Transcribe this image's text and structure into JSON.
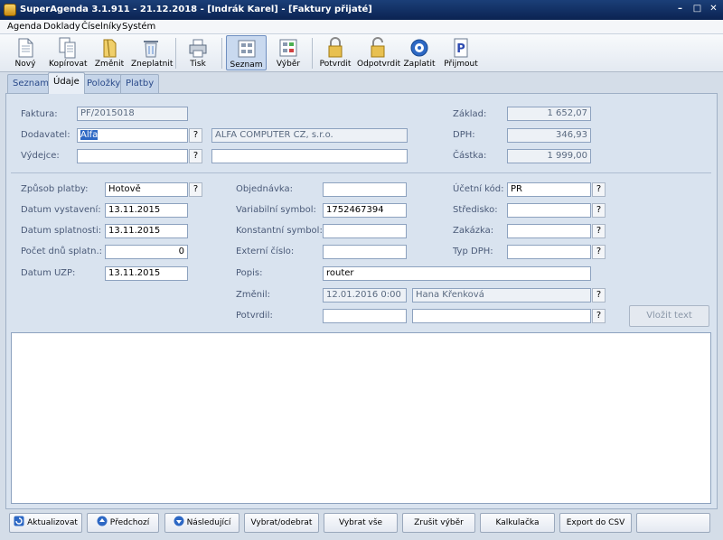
{
  "window": {
    "title": "SuperAgenda 3.1.911 - 21.12.2018 - [Indrák Karel] - [Faktury přijaté]",
    "minimize": "–",
    "restore": "□",
    "close": "✕"
  },
  "menu": [
    "Agenda",
    "Doklady",
    "Číselníky",
    "Systém"
  ],
  "toolbar": {
    "novy": "Nový",
    "kopirovat": "Kopírovat",
    "zmenit": "Změnit",
    "zneplatnit": "Zneplatnit",
    "tisk": "Tisk",
    "seznam": "Seznam",
    "vyber": "Výběr",
    "potvrdit": "Potvrdit",
    "odpotvrdit": "Odpotvrdit",
    "zaplatit": "Zaplatit",
    "prijmout": "Přijmout"
  },
  "tabs": [
    "Seznam",
    "Údaje",
    "Položky",
    "Platby"
  ],
  "form": {
    "faktura": {
      "label": "Faktura:",
      "value": "PF/2015018"
    },
    "dodavatel": {
      "label": "Dodavatel:",
      "value": "Alfa",
      "name": "ALFA COMPUTER CZ, s.r.o."
    },
    "vydejce": {
      "label": "Výdejce:",
      "value": "",
      "name": ""
    },
    "zaklad": {
      "label": "Základ:",
      "value": "1 652,07"
    },
    "dph": {
      "label": "DPH:",
      "value": "346,93"
    },
    "castka": {
      "label": "Částka:",
      "value": "1 999,00"
    },
    "zpusob_platby": {
      "label": "Způsob platby:",
      "value": "Hotově"
    },
    "datum_vystaveni": {
      "label": "Datum vystavení:",
      "value": "13.11.2015"
    },
    "datum_splatnosti": {
      "label": "Datum splatnosti:",
      "value": "13.11.2015"
    },
    "pocet_dnu": {
      "label": "Počet dnů splatn.:",
      "value": "0"
    },
    "datum_uzp": {
      "label": "Datum UZP:",
      "value": "13.11.2015"
    },
    "objednavka": {
      "label": "Objednávka:",
      "value": ""
    },
    "variabilni": {
      "label": "Variabilní symbol:",
      "value": "1752467394"
    },
    "konstantni": {
      "label": "Konstantní symbol:",
      "value": ""
    },
    "externi": {
      "label": "Externí číslo:",
      "value": ""
    },
    "popis": {
      "label": "Popis:",
      "value": "router"
    },
    "zmenil": {
      "label": "Změnil:",
      "date": "12.01.2016 0:00",
      "user": "Hana Křenková"
    },
    "potvrdil": {
      "label": "Potvrdil:",
      "date": "",
      "user": ""
    },
    "ucetni_kod": {
      "label": "Účetní kód:",
      "value": "PR"
    },
    "stredisko": {
      "label": "Středisko:",
      "value": ""
    },
    "zakazka": {
      "label": "Zakázka:",
      "value": ""
    },
    "typ_dph": {
      "label": "Typ DPH:",
      "value": ""
    },
    "help": "?",
    "vlozit_text": "Vložit text"
  },
  "bottom": {
    "aktualizovat": "Aktualizovat",
    "predchozi": "Předchozí",
    "nasledujici": "Následující",
    "vybrat_odebrat": "Vybrat/odebrat",
    "vybrat_vse": "Vybrat vše",
    "zrusit_vyber": "Zrušit výběr",
    "kalkulacka": "Kalkulačka",
    "export_csv": "Export do CSV"
  },
  "colors": {
    "titlebar": "#0b2352",
    "accent": "#2d68c4",
    "panel": "#d9e3ef"
  }
}
